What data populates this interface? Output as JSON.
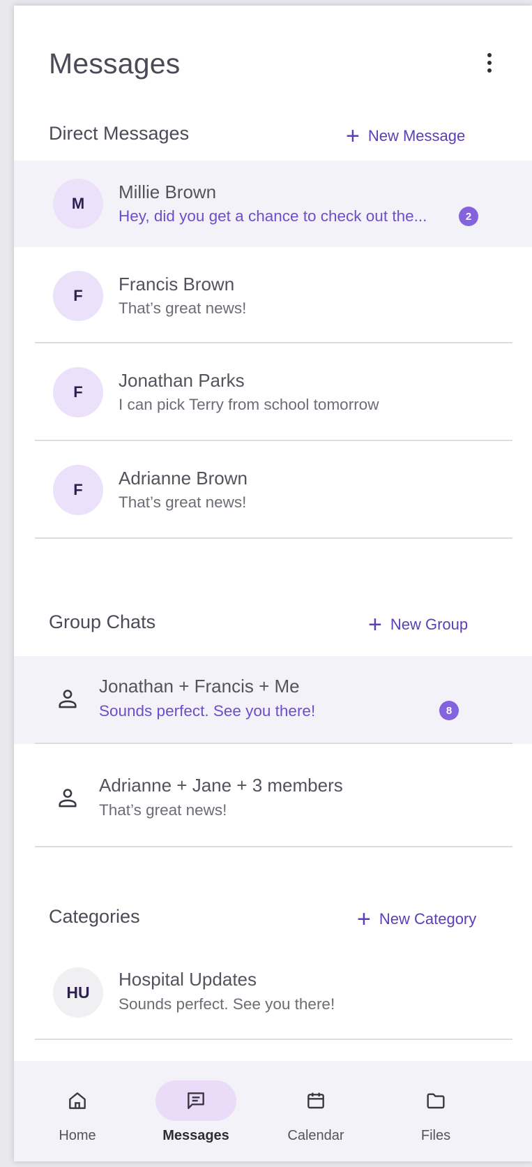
{
  "header": {
    "title": "Messages"
  },
  "direct": {
    "title": "Direct Messages",
    "action": "New Message",
    "items": [
      {
        "initial": "M",
        "name": "Millie Brown",
        "preview": "Hey, did you get a chance to check out the...",
        "badge": "2"
      },
      {
        "initial": "F",
        "name": "Francis Brown",
        "preview": "That’s great news!"
      },
      {
        "initial": "F",
        "name": "Jonathan Parks",
        "preview": "I can pick Terry from school tomorrow"
      },
      {
        "initial": "F",
        "name": "Adrianne Brown",
        "preview": "That’s great news!"
      }
    ]
  },
  "groups": {
    "title": "Group Chats",
    "action": "New Group",
    "items": [
      {
        "name": "Jonathan + Francis + Me",
        "preview": "Sounds perfect. See you there!",
        "badge": "8"
      },
      {
        "name": "Adrianne + Jane + 3 members",
        "preview": "That’s great news!"
      }
    ]
  },
  "categories": {
    "title": "Categories",
    "action": "New Category",
    "items": [
      {
        "initial": "HU",
        "name": "Hospital Updates",
        "preview": "Sounds perfect. See you there!"
      }
    ]
  },
  "nav": {
    "items": [
      {
        "label": "Home",
        "icon": "home-icon"
      },
      {
        "label": "Messages",
        "icon": "message-icon",
        "active": true
      },
      {
        "label": "Calendar",
        "icon": "calendar-icon"
      },
      {
        "label": "Files",
        "icon": "folder-icon"
      }
    ]
  },
  "colors": {
    "accent": "#5b3fb3",
    "avatar_bg": "#ebe1fb",
    "unread_bg": "#f4f2f9",
    "badge": "#8364de",
    "nav_pill": "#eadcf9"
  }
}
